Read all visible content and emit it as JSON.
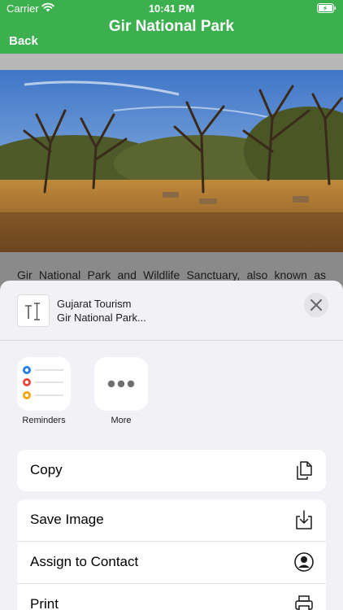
{
  "status_bar": {
    "carrier": "Carrier",
    "time": "10:41 PM"
  },
  "nav": {
    "title": "Gir National Park",
    "back_label": "Back"
  },
  "article": {
    "intro": "Gir National Park and Wildlife Sanctuary, also known as"
  },
  "share_sheet": {
    "title": "Gujarat Tourism",
    "subtitle": "Gir National Park...",
    "apps": [
      {
        "label": "Reminders",
        "icon": "reminders-icon"
      },
      {
        "label": "More",
        "icon": "more-icon"
      }
    ],
    "actions": [
      {
        "label": "Copy",
        "icon": "copy-icon"
      },
      {
        "label": "Save Image",
        "icon": "save-image-icon"
      },
      {
        "label": "Assign to Contact",
        "icon": "contact-icon"
      },
      {
        "label": "Print",
        "icon": "print-icon"
      }
    ]
  },
  "colors": {
    "header_green": "#3caf4e",
    "sheet_bg": "#f2f2f6"
  }
}
